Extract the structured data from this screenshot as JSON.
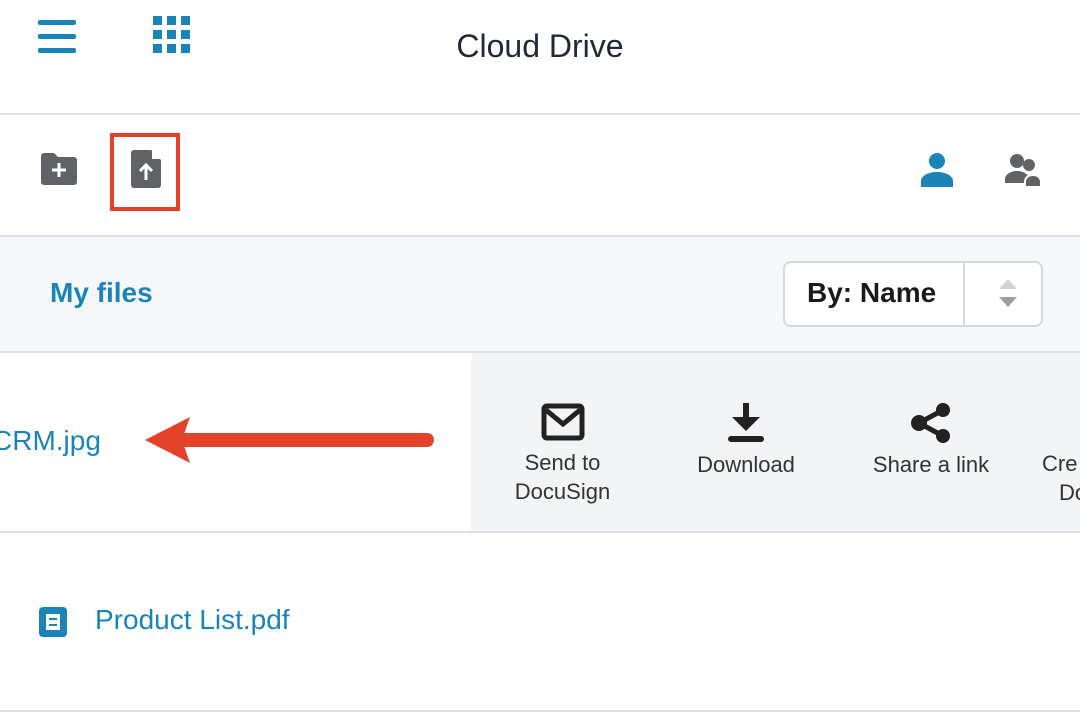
{
  "header": {
    "title": "Cloud Drive",
    "menu_icon": "hamburger-icon",
    "apps_icon": "grid-icon"
  },
  "toolbar": {
    "new_folder_icon": "folder-plus-icon",
    "upload_icon": "file-upload-icon",
    "my_files_icon": "person-icon",
    "shared_icon": "people-icon"
  },
  "files_bar": {
    "title": "My files",
    "sort_label": "By: Name"
  },
  "files": [
    {
      "name": "CRM.jpg",
      "actions": [
        {
          "label_line1": "Send to",
          "label_line2": "DocuSign",
          "icon": "envelope-icon"
        },
        {
          "label_line1": "Download",
          "label_line2": "",
          "icon": "download-icon"
        },
        {
          "label_line1": "Share a link",
          "label_line2": "",
          "icon": "share-icon"
        },
        {
          "label_line1": "Cre",
          "label_line2": "Do",
          "icon": ""
        }
      ]
    },
    {
      "name": "Product List.pdf",
      "icon": "document-icon"
    }
  ],
  "colors": {
    "accent": "#1a84b8",
    "annotation": "#e2432a",
    "icon_gray": "#5f6368"
  }
}
